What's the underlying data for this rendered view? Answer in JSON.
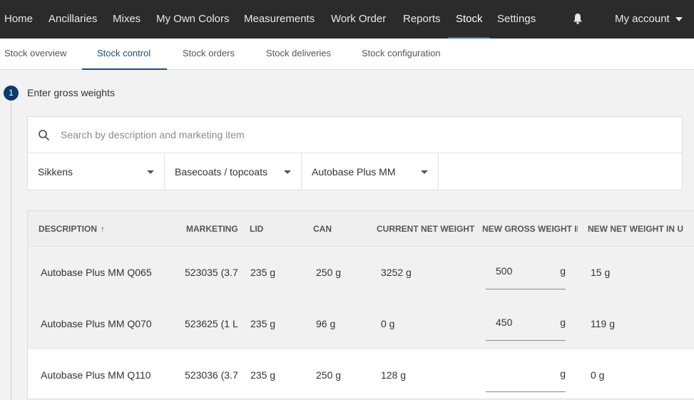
{
  "topnav": {
    "items": [
      "Home",
      "Ancillaries",
      "Mixes",
      "My Own Colors",
      "Measurements",
      "Work Order",
      "Reports",
      "Stock",
      "Settings"
    ],
    "active": "Stock",
    "account_label": "My account"
  },
  "subnav": {
    "tabs": [
      "Stock overview",
      "Stock control",
      "Stock orders",
      "Stock deliveries",
      "Stock configuration"
    ],
    "active": "Stock control"
  },
  "step": {
    "number": "1",
    "title": "Enter gross weights"
  },
  "filters": {
    "search_placeholder": "Search by description and marketing item",
    "brand": "Sikkens",
    "category": "Basecoats / topcoats",
    "product_line": "Autobase Plus MM"
  },
  "table": {
    "columns": [
      "DESCRIPTION",
      "MARKETING",
      "LID",
      "CAN",
      "CURRENT NET WEIGHT",
      "NEW GROSS WEIGHT IN",
      "NEW NET WEIGHT IN U"
    ],
    "sort_indicator": "↑",
    "rows": [
      {
        "description": "Autobase Plus MM Q065",
        "marketing": "523035 (3.7",
        "lid": "235 g",
        "can": "250 g",
        "current_net": "3252 g",
        "new_gross": "500",
        "unit": "g",
        "new_net": "15 g"
      },
      {
        "description": "Autobase Plus MM Q070",
        "marketing": "523625 (1 L",
        "lid": "235 g",
        "can": "96 g",
        "current_net": "0 g",
        "new_gross": "450",
        "unit": "g",
        "new_net": "119 g"
      },
      {
        "description": "Autobase Plus MM Q110",
        "marketing": "523036 (3.7",
        "lid": "235 g",
        "can": "250 g",
        "current_net": "128 g",
        "new_gross": "",
        "unit": "g",
        "new_net": "0 g"
      }
    ]
  },
  "colors": {
    "topbar": "#2b2b2b",
    "accent": "#1f4e79",
    "step_badge": "#0b3a6e"
  }
}
